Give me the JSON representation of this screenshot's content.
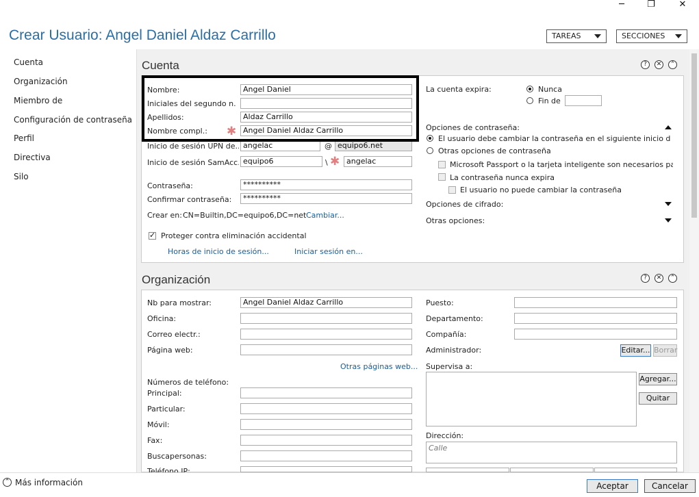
{
  "window": {
    "minimize": "─",
    "restore": "❐",
    "close": "✕"
  },
  "title": "Crear Usuario: Angel Daniel Aldaz Carrillo",
  "header": {
    "tasks": "TAREAS",
    "sections": "SECCIONES"
  },
  "sidebar": {
    "items": [
      {
        "label": "Cuenta"
      },
      {
        "label": "Organización"
      },
      {
        "label": "Miembro de"
      },
      {
        "label": "Configuración de contraseña"
      },
      {
        "label": "Perfil"
      },
      {
        "label": "Directiva"
      },
      {
        "label": "Silo"
      }
    ]
  },
  "cuenta": {
    "heading": "Cuenta",
    "nombre_label": "Nombre:",
    "nombre_value": "Angel Daniel",
    "iniciales_label": "Iniciales del segundo n...",
    "iniciales_value": "",
    "apellidos_label": "Apellidos:",
    "apellidos_value": "Aldaz Carrillo",
    "nombre_compl_label": "Nombre compl.:",
    "nombre_compl_value": "Angel Daniel Aldaz Carrillo",
    "upn_label": "Inicio de sesión UPN de...",
    "upn_user": "angelac",
    "upn_at": "@",
    "upn_domain": "equipo6.net",
    "sam_label": "Inicio de sesión SamAcc...",
    "sam_domain": "equipo6",
    "sam_sep": "\\",
    "sam_user": "angelac",
    "pwd_label": "Contraseña:",
    "pwd_value": "**********",
    "pwd2_label": "Confirmar contraseña:",
    "pwd2_value": "**********",
    "crear_en_label": "Crear en:",
    "crear_en_value": "CN=Builtin,DC=equipo6,DC=net",
    "cambiar_link": "Cambiar...",
    "protect_label": "Proteger contra eliminación accidental",
    "horas_link": "Horas de inicio de sesión...",
    "iniciar_link": "Iniciar sesión en...",
    "expira_label": "La cuenta expira:",
    "nunca": "Nunca",
    "fin_de": "Fin de",
    "opciones_pwd": "Opciones de contraseña:",
    "opt_must_change": "El usuario debe cambiar la contraseña en el siguiente inicio de...",
    "opt_otras": "Otras opciones de contraseña",
    "opt_passport": "Microsoft Passport o la tarjeta inteligente son necesarios pa...",
    "opt_never_expires": "La contraseña nunca expira",
    "opt_cannot_change": "El usuario no puede cambiar la contraseña",
    "opciones_cifrado": "Opciones de cifrado:",
    "otras_opciones": "Otras opciones:"
  },
  "organizacion": {
    "heading": "Organización",
    "nb_label": "Nb para mostrar:",
    "nb_value": "Angel Daniel Aldaz Carrillo",
    "oficina_label": "Oficina:",
    "correo_label": "Correo electr.:",
    "web_label": "Página web:",
    "otras_web_link": "Otras páginas web...",
    "telefonos_label": "Números de teléfono:",
    "principal_label": "Principal:",
    "particular_label": "Particular:",
    "movil_label": "Móvil:",
    "fax_label": "Fax:",
    "buscapersonas_label": "Buscapersonas:",
    "telefono_ip_label": "Teléfono IP:",
    "puesto_label": "Puesto:",
    "departamento_label": "Departamento:",
    "compania_label": "Compañía:",
    "administrador_label": "Administrador:",
    "editar": "Editar...",
    "borrar": "Borrar",
    "supervisa_label": "Supervisa a:",
    "agregar": "Agregar...",
    "quitar": "Quitar",
    "direccion_label": "Dirección:",
    "calle_placeholder": "Calle"
  },
  "panel_controls": {
    "help": "?",
    "close": "✕",
    "collapse": "⌃"
  },
  "footer": {
    "mas_info": "Más información",
    "aceptar": "Aceptar",
    "cancelar": "Cancelar"
  }
}
